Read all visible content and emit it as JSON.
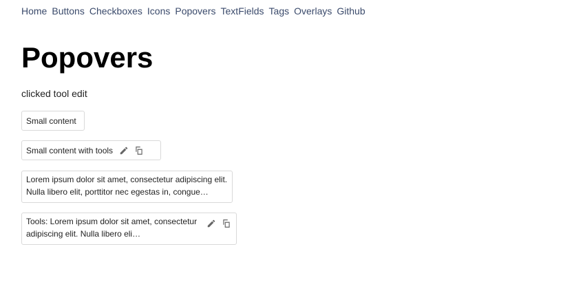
{
  "nav": {
    "items": [
      {
        "label": "Home"
      },
      {
        "label": "Buttons"
      },
      {
        "label": "Checkboxes"
      },
      {
        "label": "Icons"
      },
      {
        "label": "Popovers"
      },
      {
        "label": "TextFields"
      },
      {
        "label": "Tags"
      },
      {
        "label": "Overlays"
      },
      {
        "label": "Github"
      }
    ],
    "link_color": "#3a4a6b"
  },
  "page": {
    "title": "Popovers",
    "status": "clicked tool edit"
  },
  "popovers": [
    {
      "text": "Small content"
    },
    {
      "text": "Small content with tools",
      "tools": [
        "pencil-icon",
        "copy-icon"
      ]
    },
    {
      "text": "Lorem ipsum dolor sit amet, consectetur adipiscing elit. Nulla libero elit, porttitor nec egestas in, congue…"
    },
    {
      "text": "Tools: Lorem ipsum dolor sit amet, consectetur adipiscing elit. Nulla libero eli…",
      "tools": [
        "pencil-icon",
        "copy-icon"
      ]
    }
  ],
  "colors": {
    "border": "#d9d9d9",
    "icon": "#666666"
  }
}
